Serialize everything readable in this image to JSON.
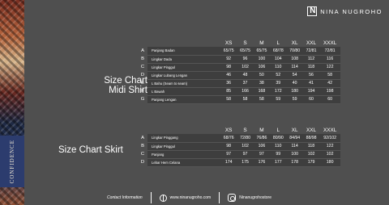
{
  "brand": {
    "name": "NINA NUGROHO"
  },
  "side_text": "CONFIDENCE",
  "shirt": {
    "title_line1": "Size Chart",
    "title_line2": "Midi Shirt",
    "headers": [
      "XS",
      "S",
      "M",
      "L",
      "XL",
      "XXL",
      "XXXL"
    ],
    "rows": [
      {
        "letter": "A",
        "label": "Panjang Badan",
        "values": [
          "65/75",
          "65/75",
          "65/75",
          "68/78",
          "70/80",
          "72/81",
          "72/81"
        ]
      },
      {
        "letter": "B",
        "label": "Lingkar Dada",
        "values": [
          "92",
          "96",
          "100",
          "104",
          "108",
          "112",
          "116"
        ]
      },
      {
        "letter": "C",
        "label": "Lingkar Pinggul",
        "values": [
          "98",
          "102",
          "106",
          "110",
          "114",
          "118",
          "122"
        ]
      },
      {
        "letter": "D",
        "label": "Lingkar Lubang Lengan",
        "values": [
          "46",
          "48",
          "50",
          "52",
          "54",
          "56",
          "58"
        ]
      },
      {
        "letter": "E",
        "label": "L Bahu (Seam to seam)",
        "values": [
          "36",
          "37",
          "38",
          "39",
          "40",
          "41",
          "42"
        ]
      },
      {
        "letter": "F",
        "label": "L Bawah",
        "values": [
          "85",
          "166",
          "168",
          "172",
          "180",
          "194",
          "198"
        ]
      },
      {
        "letter": "G",
        "label": "Panjang Lengan",
        "values": [
          "58",
          "58",
          "58",
          "59",
          "59",
          "60",
          "60"
        ]
      }
    ]
  },
  "skirt": {
    "title": "Size Chart Skirt",
    "headers": [
      "XS",
      "S",
      "M",
      "L",
      "XL",
      "XXL",
      "XXXL"
    ],
    "rows": [
      {
        "letter": "A",
        "label": "Lingkar Pinggang",
        "values": [
          "68/76",
          "72/80",
          "76/86",
          "80/90",
          "84/94",
          "88/98",
          "92/102"
        ]
      },
      {
        "letter": "B",
        "label": "Lingkar Pinggul",
        "values": [
          "98",
          "102",
          "106",
          "110",
          "114",
          "118",
          "122"
        ]
      },
      {
        "letter": "C",
        "label": "Panjang",
        "values": [
          "97",
          "97",
          "97",
          "99",
          "100",
          "102",
          "102"
        ]
      },
      {
        "letter": "D",
        "label": "Lebar Hem Celana",
        "values": [
          "174",
          "175",
          "176",
          "177",
          "178",
          "179",
          "180"
        ]
      }
    ]
  },
  "footer": {
    "contact": "Contact Information",
    "website": "www.ninanugroho.com",
    "instagram": "Ninanugrohostore"
  }
}
